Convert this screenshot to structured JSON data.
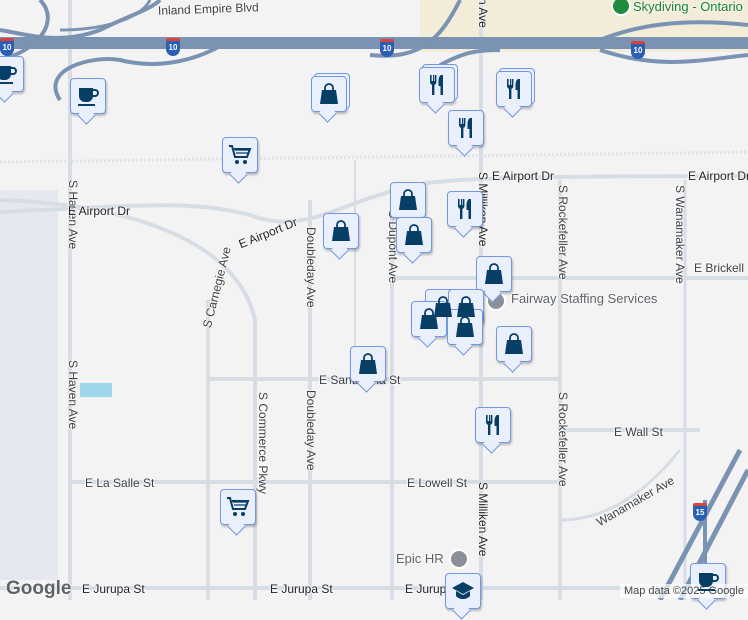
{
  "streets": {
    "inland_empire": "Inland Empire Blvd",
    "haven_top": "S Haven Ave",
    "haven_bottom": "S Haven Ave",
    "airport_left": "E Airport Dr",
    "airport_mid": "E Airport Dr",
    "airport_right": "E Airport Dr",
    "airport_far": "E Airport Dr",
    "carnegie": "S Carnegie Ave",
    "doubleday_top": "Doubleday Ave",
    "doubleday_bottom": "Doubleday Ave",
    "dupont": "S Dupont Ave",
    "commerce": "S Commerce Pkwy",
    "milliken_top": "n Ave",
    "milliken_mid": "S Milliken Ave",
    "milliken_bottom": "S Milliken Ave",
    "rockefeller_top": "S Rockefeller Ave",
    "rockefeller_bottom": "S Rockefeller Ave",
    "wanamaker_top": "S Wanamaker Ave",
    "wanamaker_bottom": "Wanamaker Ave",
    "brickell": "E Brickell St",
    "santa": "E Santa Ana St",
    "wall": "E Wall St",
    "la_salle": "E La Salle St",
    "lowell": "E Lowell St",
    "jurupa_left": "E Jurupa St",
    "jurupa_mid": "E Jurupa St",
    "jurupa_right": "E Jurupa St"
  },
  "highways": {
    "i10": "10",
    "i15": "15"
  },
  "pois": {
    "skydiving": "Skydiving - Ontario",
    "fairway": "Fairway Staffing Services",
    "epic": "Epic HR"
  },
  "branding": {
    "logo": "Google",
    "attribution": "Map data ©2025 Google"
  },
  "colors": {
    "marker_bg": "#e9effb",
    "marker_border": "#7397e2",
    "icon": "#063e66",
    "freeway": "#7b93b3"
  }
}
